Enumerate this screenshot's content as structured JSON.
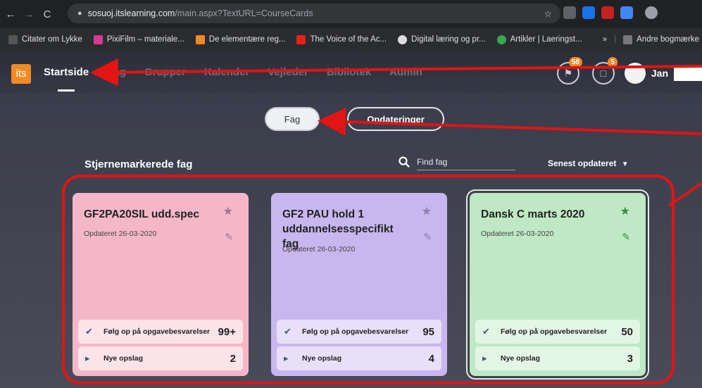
{
  "browser": {
    "url_host": "sosuoj.itslearning.com",
    "url_path": "/main.aspx?TextURL=CourseCards",
    "bookmarks": [
      "Citater om Lykke",
      "PixiFilm – materiale...",
      "De elementære reg...",
      "The Voice of the Ac...",
      "Digital læring og pr...",
      "Artikler | Laeringst..."
    ],
    "bookmarks_more": "»",
    "other_bookmarks": "Andre bogmærke"
  },
  "app": {
    "logo": "its",
    "nav": [
      "Startside",
      "Fag",
      "Grupper",
      "Kalender",
      "Vejleder",
      "Bibliotek",
      "Admin"
    ],
    "notifications_badge": "58",
    "messages_badge": "5",
    "user_name": "Jan"
  },
  "main": {
    "toggle_fag": "Fag",
    "toggle_updates": "Opdateringer",
    "section_title": "Stjernemarkerede fag",
    "search_placeholder": "Find fag",
    "sort_label": "Senest opdateret"
  },
  "cards": [
    {
      "title": "GF2PA20SIL udd.spec",
      "updated": "Opdateret 26-03-2020",
      "follow_label": "Følg op på opgavebesvarelser",
      "follow_count": "99+",
      "posts_label": "Nye opslag",
      "posts_count": "2",
      "color": "#f4b7c9",
      "stat_color": "#fbe3ea",
      "star_color": "#9a7b87"
    },
    {
      "title": "GF2 PAU hold 1 uddannelsesspecifikt fag",
      "updated": "Opdateret 26-03-2020",
      "follow_label": "Følg op på opgavebesvarelser",
      "follow_count": "95",
      "posts_label": "Nye opslag",
      "posts_count": "4",
      "color": "#c8b7ef",
      "stat_color": "#e8dff8",
      "star_color": "#8a7fa8"
    },
    {
      "title": "Dansk C marts 2020",
      "updated": "Opdateret 26-03-2020",
      "follow_label": "Følg op på opgavebesvarelser",
      "follow_count": "50",
      "posts_label": "Nye opslag",
      "posts_count": "3",
      "color": "#bfe9c4",
      "stat_color": "#e3f5e5",
      "star_color": "#3d8a45"
    }
  ],
  "colors": {
    "accent_orange": "#f08a24",
    "annotation_red": "#e21414",
    "check_color": "#3e5c76"
  }
}
